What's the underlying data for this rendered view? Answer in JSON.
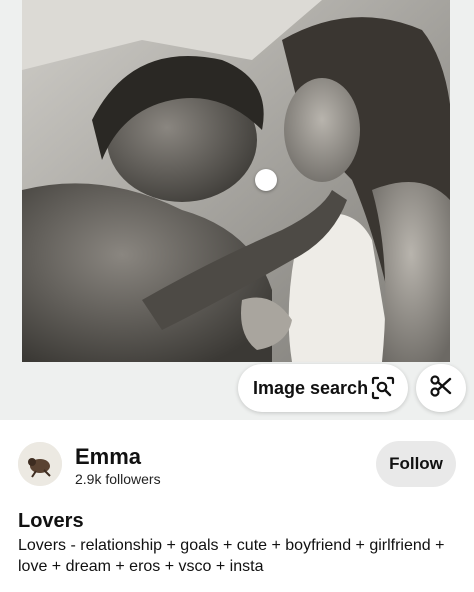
{
  "pin": {
    "image_description_icon": "photo",
    "image_search_label": "Image search",
    "image_search_icon": "visual-search-icon",
    "scissors_icon": "scissors-icon",
    "title": "Lovers",
    "description": "Lovers - relationship + goals + cute + boyfriend + girlfriend + love + dream + eros + vsco + insta"
  },
  "creator": {
    "name": "Emma",
    "followers": "2.9k followers",
    "follow_label": "Follow"
  },
  "colors": {
    "button_bg": "#ffffff",
    "follow_bg": "#e9e9e9",
    "text": "#111111"
  }
}
